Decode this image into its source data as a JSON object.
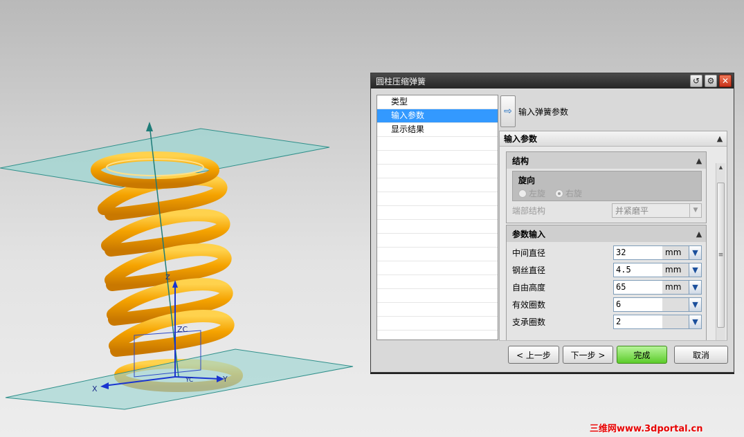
{
  "dialog": {
    "title": "圆柱压缩弹簧",
    "icons": [
      "reset-icon",
      "gear-icon",
      "close-icon"
    ],
    "steps": [
      "类型",
      "输入参数",
      "显示结果"
    ],
    "selected_step": "输入参数",
    "step_header": "输入弹簧参数",
    "panel_title": "输入参数",
    "structure": {
      "title": "结构",
      "rotation_title": "旋向",
      "left_label": "左旋",
      "right_label": "右旋",
      "end_label": "端部结构",
      "end_value": "并紧磨平"
    },
    "param_input": {
      "title": "参数输入",
      "rows": [
        {
          "label": "中间直径",
          "value": "32",
          "unit": "mm"
        },
        {
          "label": "钢丝直径",
          "value": "4.5",
          "unit": "mm"
        },
        {
          "label": "自由高度",
          "value": "65",
          "unit": "mm"
        },
        {
          "label": "有效圈数",
          "value": "6",
          "unit": ""
        },
        {
          "label": "支承圈数",
          "value": "2",
          "unit": ""
        }
      ]
    },
    "buttons": {
      "back": "< 上一步",
      "next": "下一步 >",
      "finish": "完成",
      "cancel": "取消"
    }
  },
  "viewport": {
    "axis_labels": {
      "zc": "ZC",
      "x": "X",
      "y": "Y",
      "z": "Z",
      "yc": "YC"
    },
    "spring_color": "#f2a000",
    "plane_color": "#8fd2cf"
  },
  "watermark": "三维网www.3dportal.cn"
}
